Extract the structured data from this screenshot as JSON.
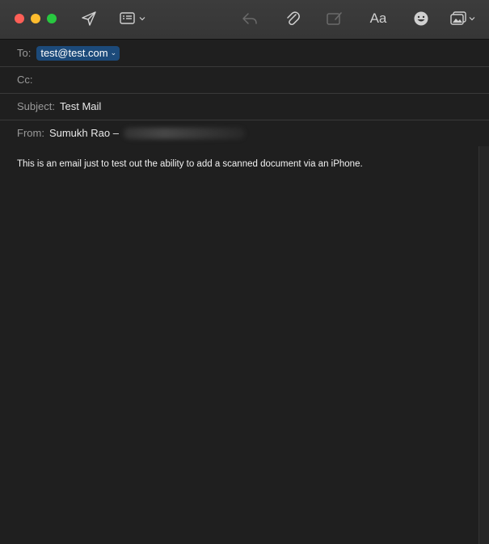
{
  "window": {
    "background": "#1f1f1f"
  },
  "toolbar": {
    "buttons": [
      {
        "name": "send",
        "icon": "paper-plane-icon"
      },
      {
        "name": "header-fields",
        "icon": "list-window-icon"
      },
      {
        "name": "reply",
        "icon": "reply-arrow-icon",
        "enabled": false
      },
      {
        "name": "attach",
        "icon": "paperclip-icon"
      },
      {
        "name": "markup",
        "icon": "markup-pencil-icon",
        "enabled": false
      },
      {
        "name": "format",
        "label": "Aa"
      },
      {
        "name": "emoji",
        "icon": "smiley-icon"
      },
      {
        "name": "photo-browser",
        "icon": "photo-icon"
      }
    ],
    "format_label": "Aa"
  },
  "header": {
    "to": {
      "label": "To:",
      "recipient": "test@test.com"
    },
    "cc": {
      "label": "Cc:",
      "value": ""
    },
    "subject": {
      "label": "Subject:",
      "value": "Test Mail"
    },
    "from": {
      "label": "From:",
      "value": "Sumukh Rao –"
    }
  },
  "message": {
    "body": "This is an email just to test out the ability to add a scanned document via an iPhone."
  },
  "colors": {
    "close": "#fe5f57",
    "minimize": "#febc2e",
    "maximize": "#28c840",
    "recipient_token": "#1c4a7a"
  }
}
